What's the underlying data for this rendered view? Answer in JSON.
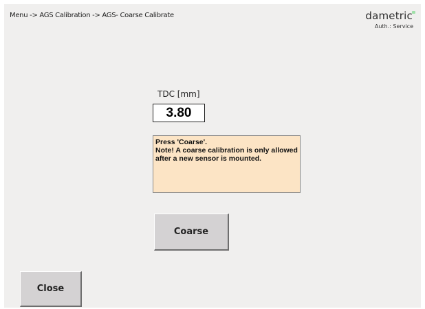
{
  "header": {
    "breadcrumb": "Menu -> AGS Calibration -> AGS- Coarse Calibrate",
    "brand": "dametric",
    "auth": "Auth.: Service"
  },
  "tdc": {
    "label": "TDC [mm]",
    "value": "3.80"
  },
  "message": {
    "lines": [
      "Press 'Coarse'.",
      "Note! A coarse calibration is only allowed after a new sensor is mounted."
    ]
  },
  "buttons": {
    "coarse_label": "Coarse",
    "close_label": "Close"
  },
  "colors": {
    "background": "#f0efee",
    "message_bg": "#fce4c5",
    "button_face": "#d4d2d3",
    "brand_accent": "#9fe0a8"
  }
}
